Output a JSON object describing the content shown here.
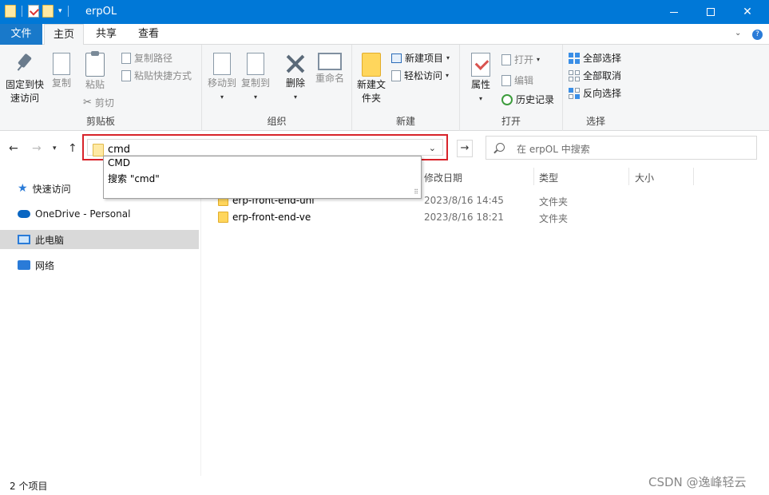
{
  "window": {
    "title": "erpOL"
  },
  "tabs": {
    "file": "文件",
    "home": "主页",
    "share": "共享",
    "view": "查看"
  },
  "ribbon": {
    "clipboard": {
      "label": "剪贴板",
      "pin": "固定到快速访问",
      "copy": "复制",
      "paste": "粘贴",
      "copy_path": "复制路径",
      "paste_shortcut": "粘贴快捷方式",
      "cut": "剪切"
    },
    "organize": {
      "label": "组织",
      "move_to": "移动到",
      "copy_to": "复制到",
      "delete": "删除",
      "rename": "重命名"
    },
    "new": {
      "label": "新建",
      "new_folder": "新建文件夹",
      "new_item": "新建项目",
      "easy_access": "轻松访问"
    },
    "open": {
      "label": "打开",
      "properties": "属性",
      "open": "打开",
      "edit": "编辑",
      "history": "历史记录"
    },
    "select": {
      "label": "选择",
      "select_all": "全部选择",
      "select_none": "全部取消",
      "invert": "反向选择"
    }
  },
  "address": {
    "value": "cmd"
  },
  "search": {
    "placeholder": "在 erpOL 中搜索"
  },
  "suggestions": [
    "CMD",
    "搜索 \"cmd\""
  ],
  "sidebar": {
    "items": [
      {
        "label": "快速访问"
      },
      {
        "label": "OneDrive - Personal"
      },
      {
        "label": "此电脑"
      },
      {
        "label": "网络"
      }
    ]
  },
  "columns": {
    "date": "修改日期",
    "type": "类型",
    "size": "大小"
  },
  "files": [
    {
      "name": "erp-front-end-uni",
      "date": "2023/8/16 14:45",
      "type": "文件夹"
    },
    {
      "name": "erp-front-end-ve",
      "date": "2023/8/16 18:21",
      "type": "文件夹"
    }
  ],
  "status": {
    "count": "2 个项目"
  },
  "watermark": "CSDN @逸峰轻云"
}
